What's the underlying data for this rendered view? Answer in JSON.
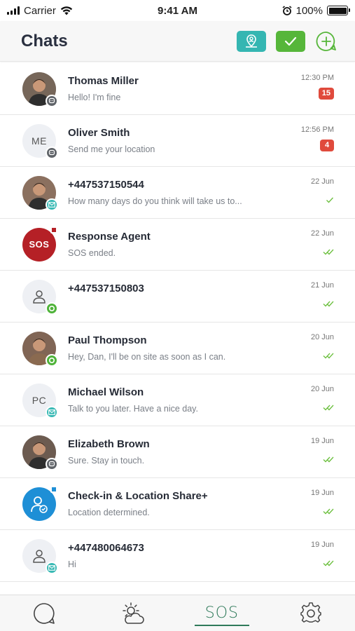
{
  "status_bar": {
    "carrier": "Carrier",
    "time": "9:41 AM",
    "battery": "100%"
  },
  "header": {
    "title": "Chats"
  },
  "chats": [
    {
      "name": "Thomas Miller",
      "preview": "Hello! I'm fine",
      "time": "12:30 PM",
      "badge": "15",
      "avatar": "photo",
      "initials": "",
      "status": "chat-gray",
      "ticks": ""
    },
    {
      "name": "Oliver Smith",
      "preview": "Send me your location",
      "time": "12:56 PM",
      "badge": "4",
      "avatar": "initials",
      "initials": "ME",
      "status": "chat-gray",
      "ticks": ""
    },
    {
      "name": "+447537150544",
      "preview": "How many days do you think will take us to...",
      "time": "22 Jun",
      "badge": "",
      "avatar": "photo",
      "initials": "",
      "status": "mail-teal",
      "ticks": "single"
    },
    {
      "name": "Response Agent",
      "preview": "SOS ended.",
      "time": "22 Jun",
      "badge": "",
      "avatar": "sos",
      "initials": "SOS",
      "status": "",
      "ticks": "double"
    },
    {
      "name": "+447537150803",
      "preview": "",
      "time": "21 Jun",
      "badge": "",
      "avatar": "person",
      "initials": "",
      "status": "ring-green",
      "ticks": "double"
    },
    {
      "name": "Paul Thompson",
      "preview": "Hey, Dan, I'll be on site as soon as I can.",
      "time": "20 Jun",
      "badge": "",
      "avatar": "photo",
      "initials": "",
      "status": "ring-green",
      "ticks": "double"
    },
    {
      "name": "Michael Wilson",
      "preview": "Talk to you later. Have a nice day.",
      "time": "20 Jun",
      "badge": "",
      "avatar": "initials",
      "initials": "PC",
      "status": "mail-teal",
      "ticks": "double"
    },
    {
      "name": "Elizabeth Brown",
      "preview": "Sure. Stay in touch.",
      "time": "19 Jun",
      "badge": "",
      "avatar": "photo",
      "initials": "",
      "status": "chat-gray",
      "ticks": "double"
    },
    {
      "name": "Check-in & Location Share+",
      "preview": "Location determined.",
      "time": "19 Jun",
      "badge": "",
      "avatar": "checkin",
      "initials": "",
      "status": "",
      "ticks": "double"
    },
    {
      "name": "+447480064673",
      "preview": "Hi",
      "time": "19 Jun",
      "badge": "",
      "avatar": "person",
      "initials": "",
      "status": "mail-teal",
      "ticks": "double"
    }
  ],
  "tab_bar": {
    "sos_label": "SOS",
    "active_tab": "sos"
  },
  "colors": {
    "teal": "#35b6b2",
    "green": "#56b63a",
    "badge_red": "#e04a3c",
    "sos_red": "#b52026",
    "checkin_blue": "#1e8fd6",
    "tab_active": "#2f7a5a"
  }
}
